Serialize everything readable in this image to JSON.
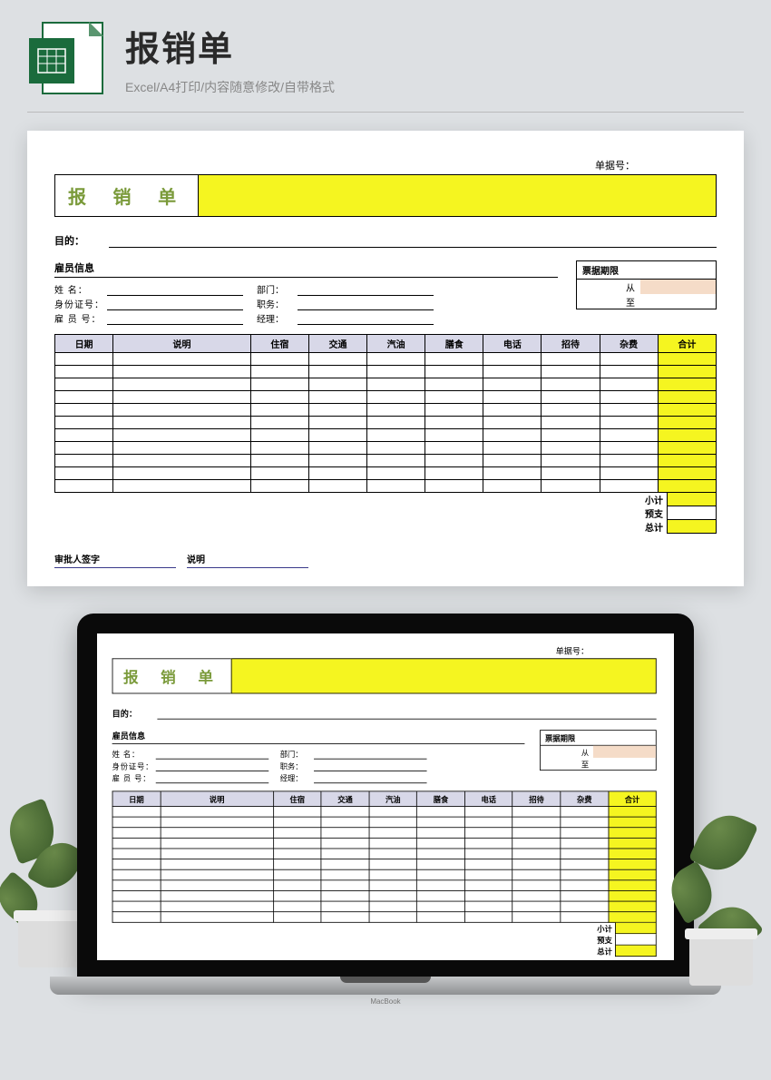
{
  "header": {
    "main_title": "报销单",
    "sub_title": "Excel/A4打印/内容随意修改/自带格式",
    "icon_label": "X"
  },
  "document": {
    "doc_number_label": "单据号：",
    "title": "报 销 单",
    "purpose_label": "目的：",
    "employee": {
      "section_title": "雇员信息",
      "name_label": "姓 名：",
      "dept_label": "部门：",
      "id_label": "身份证号：",
      "position_label": "职务：",
      "emp_no_label": "雇 员 号：",
      "manager_label": "经理："
    },
    "period": {
      "title": "票据期限",
      "from_label": "从",
      "to_label": "至"
    },
    "table": {
      "headers": [
        "日期",
        "说明",
        "住宿",
        "交通",
        "汽油",
        "膳食",
        "电话",
        "招待",
        "杂费",
        "合计"
      ],
      "row_count": 11
    },
    "summary": {
      "subtotal": "小计",
      "advance": "预支",
      "total": "总计"
    },
    "signature": {
      "approver": "审批人签字",
      "notes": "说明"
    }
  },
  "laptop": {
    "brand": "MacBook"
  }
}
